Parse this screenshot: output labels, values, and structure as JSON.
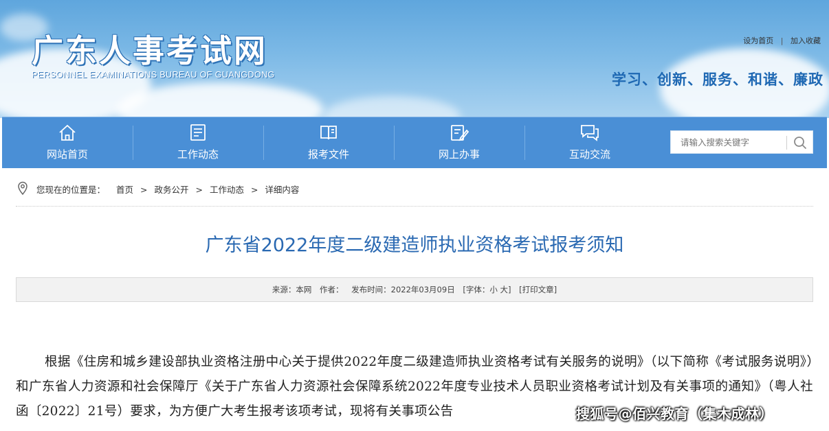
{
  "header": {
    "logo_title": "广东人事考试网",
    "logo_subtitle": "PERSONNEL EXAMINATIONS BUREAU OF GUANGDONG",
    "top_links": [
      "设为首页",
      "加入收藏"
    ],
    "top_link_separator": "|",
    "slogan": "学习、创新、服务、和谐、廉政"
  },
  "nav": {
    "items": [
      {
        "label": "网站首页",
        "icon": "home-icon"
      },
      {
        "label": "工作动态",
        "icon": "news-icon"
      },
      {
        "label": "报考文件",
        "icon": "book-icon"
      },
      {
        "label": "网上办事",
        "icon": "edit-icon"
      },
      {
        "label": "互动交流",
        "icon": "chat-icon"
      }
    ],
    "search_placeholder": "请输入搜索关键字"
  },
  "breadcrumb": {
    "prefix": "您现在的位置是：",
    "items": [
      "首页",
      "政务公开",
      "工作动态",
      "详细内容"
    ],
    "separator": ">"
  },
  "article": {
    "title": "广东省2022年度二级建造师执业资格考试报考须知",
    "meta": {
      "source": "来源：本网",
      "author": "作者：",
      "publish_time": "发布时间：2022年03月09日",
      "font_size": "[字体：小 大]",
      "print": "[打印文章]"
    },
    "body": "根据《住房和城乡建设部执业资格注册中心关于提供2022年度二级建造师执业资格考试有关服务的说明》（以下简称《考试服务说明》）和广东省人力资源和社会保障厅《关于广东省人力资源社会保障系统2022年度专业技术人员职业资格考试计划及有关事项的通知》（粤人社函〔2022〕21号）要求，为方便广大考生报考该项考试，现将有关事项公告"
  },
  "watermark": "搜狐号@佰兴教育（集木成林）",
  "colors": {
    "nav_bg": "#4a8fd6",
    "title": "#2a69b2",
    "slogan": "#1e68b3"
  }
}
